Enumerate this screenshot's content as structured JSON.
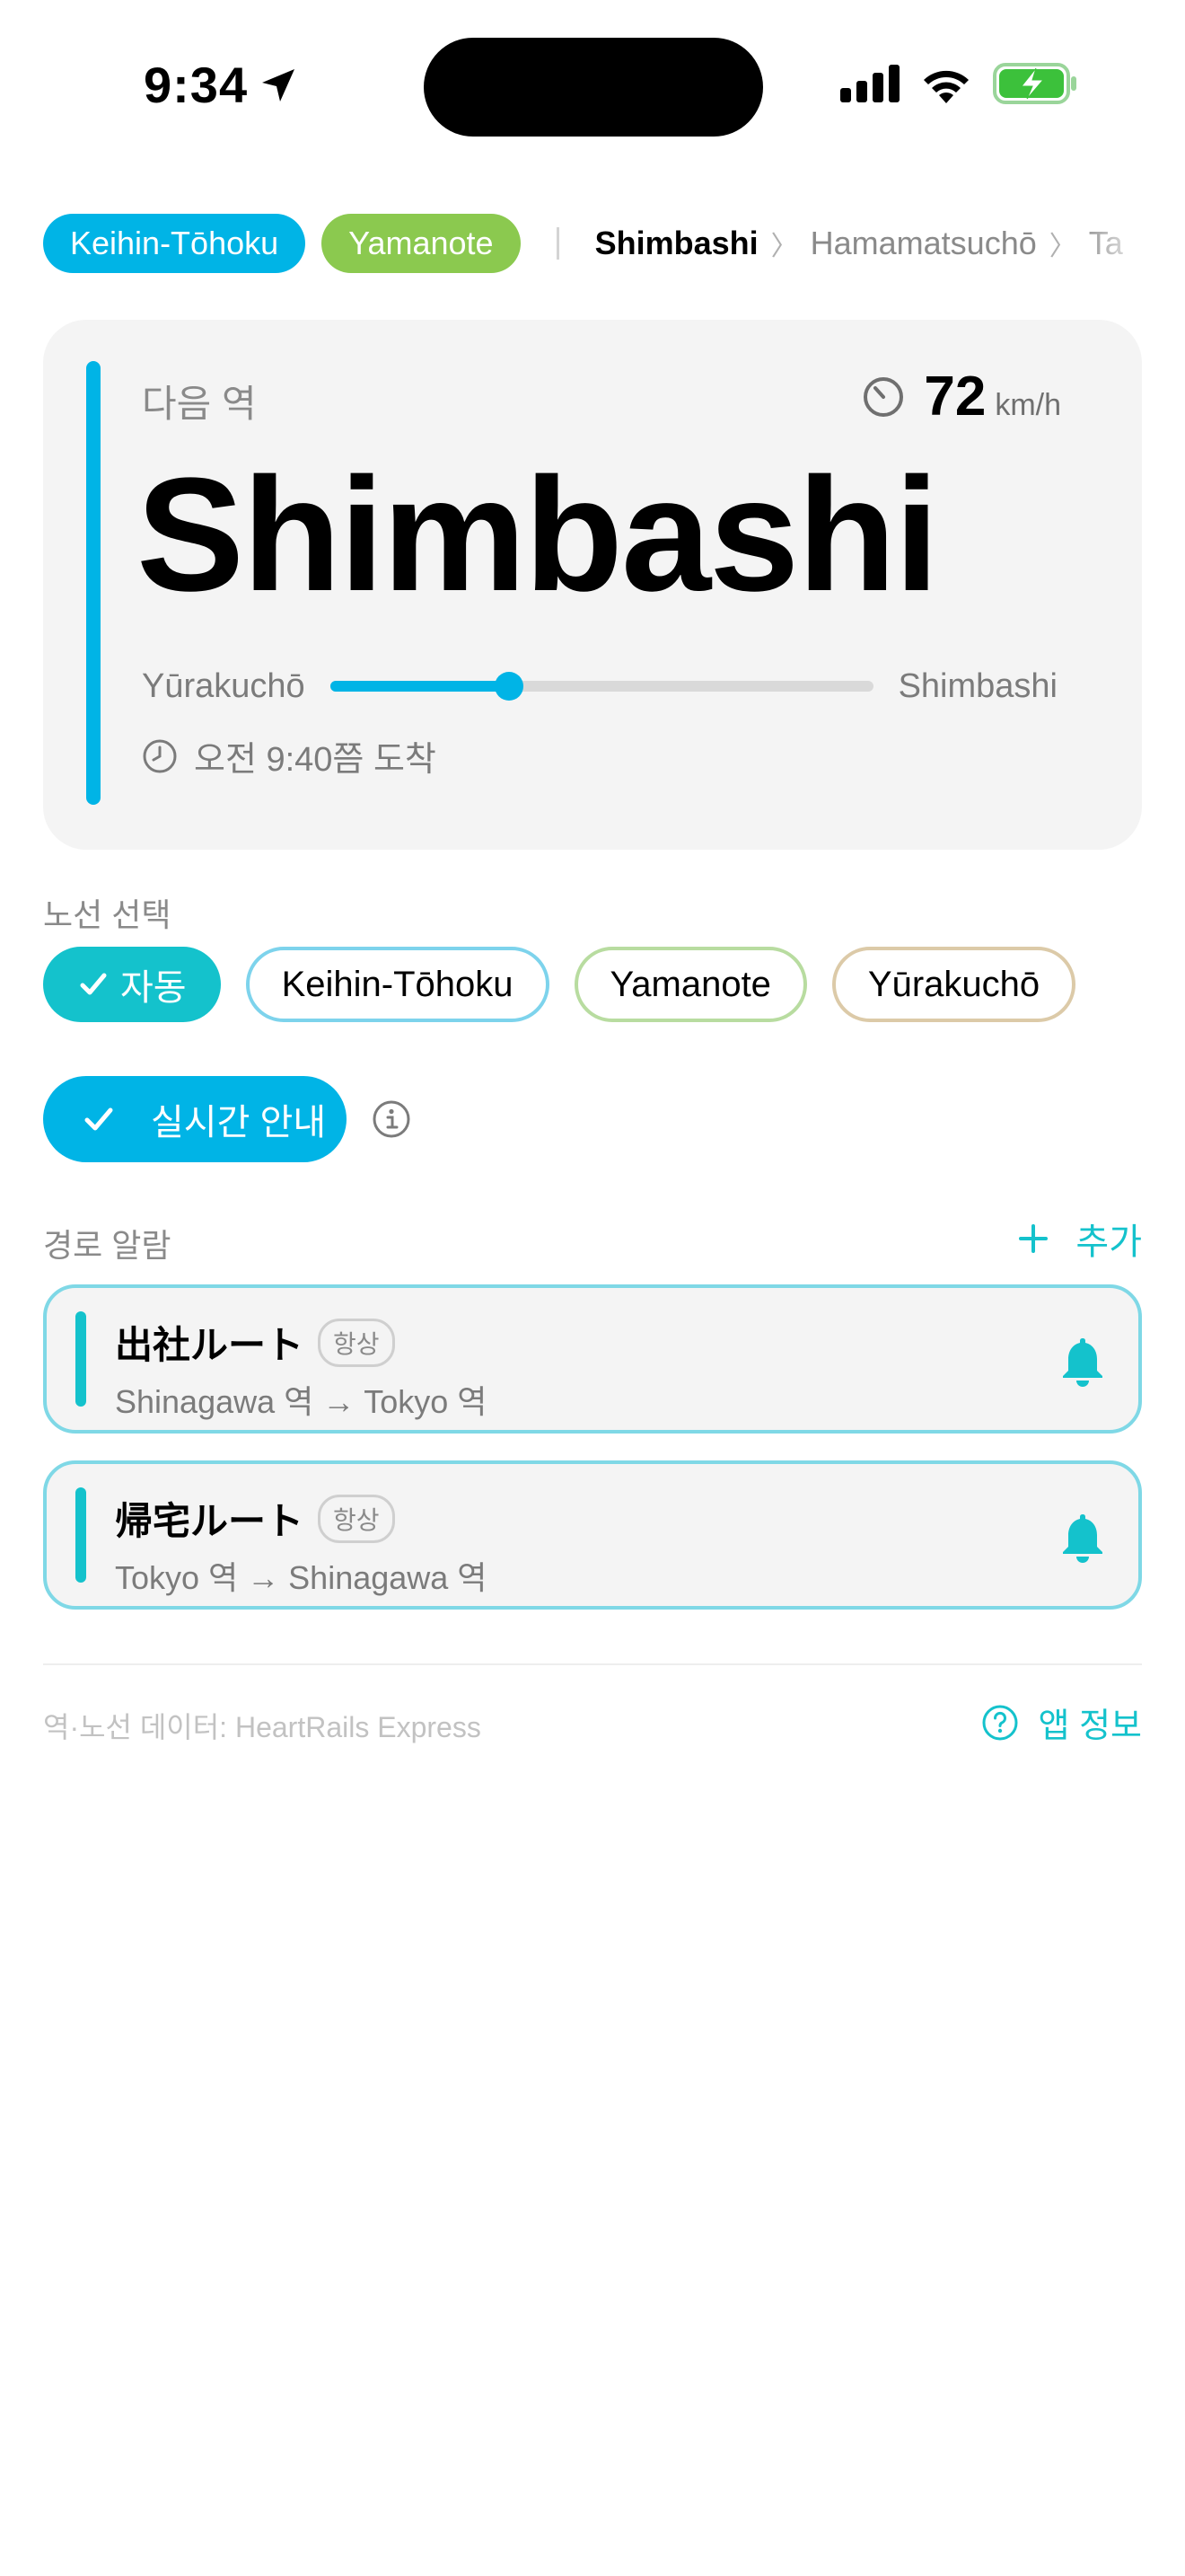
{
  "status_bar": {
    "time": "9:34"
  },
  "route_strip": {
    "lines": [
      {
        "label": "Keihin-Tōhoku",
        "color": "#00b4e6"
      },
      {
        "label": "Yamanote",
        "color": "#8bc94f"
      }
    ],
    "stations": [
      "Shimbashi",
      "Hamamatsuchō",
      "Ta"
    ]
  },
  "next_station": {
    "label": "다음 역",
    "speed_value": "72",
    "speed_unit": "km/h",
    "name": "Shimbashi",
    "from": "Yūrakuchō",
    "to": "Shimbashi",
    "progress": 0.33,
    "arrival": "오전 9:40쯤 도착",
    "accent_color": "#00b4e6"
  },
  "line_select": {
    "label": "노선 선택",
    "options": [
      {
        "label": "자동",
        "active": true,
        "border": "#14c2cc"
      },
      {
        "label": "Keihin-Tōhoku",
        "active": false,
        "border": "#7dd3ec"
      },
      {
        "label": "Yamanote",
        "active": false,
        "border": "#b8dca0"
      },
      {
        "label": "Yūrakuchō",
        "active": false,
        "border": "#dccaa8"
      }
    ]
  },
  "live_guide": {
    "label": "실시간 안내"
  },
  "route_alarms": {
    "label": "경로 알람",
    "add_label": "추가",
    "items": [
      {
        "title": "出社ルート",
        "badge": "항상",
        "route": "Shinagawa 역 → Tokyo 역"
      },
      {
        "title": "帰宅ルート",
        "badge": "항상",
        "route": "Tokyo 역 → Shinagawa 역"
      }
    ]
  },
  "footer": {
    "credit": "역·노선 데이터: HeartRails Express",
    "about": "앱 정보"
  },
  "colors": {
    "accent_blue": "#00b4e6",
    "accent_teal": "#14c2cc",
    "yamanote_green": "#8bc94f"
  }
}
